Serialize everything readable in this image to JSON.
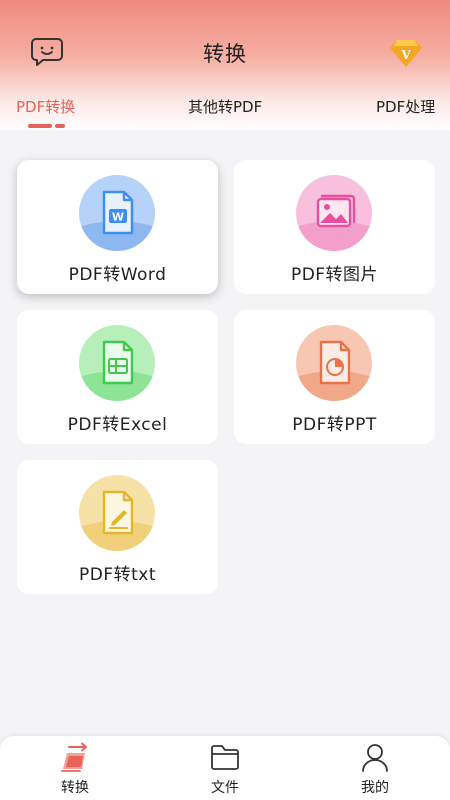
{
  "header": {
    "title": "转换",
    "chat_icon": "chat-bubble-smile-icon",
    "vip_icon": "vip-diamond-icon",
    "vip_letter": "V"
  },
  "tabs": [
    {
      "label": "PDF转换",
      "active": true
    },
    {
      "label": "其他转PDF",
      "active": false
    },
    {
      "label": "PDF处理",
      "active": false
    }
  ],
  "cards": [
    {
      "label": "PDF转Word",
      "icon": "word-file-icon",
      "icon_letter": "W",
      "color": "#3d8ef0"
    },
    {
      "label": "PDF转图片",
      "icon": "image-file-icon",
      "color": "#e84fa0"
    },
    {
      "label": "PDF转Excel",
      "icon": "excel-file-icon",
      "color": "#42c94f"
    },
    {
      "label": "PDF转PPT",
      "icon": "ppt-file-icon",
      "color": "#e8734a"
    },
    {
      "label": "PDF转txt",
      "icon": "txt-file-icon",
      "color": "#e5b52c"
    }
  ],
  "bottom_nav": [
    {
      "label": "转换",
      "icon": "convert-icon",
      "active": true
    },
    {
      "label": "文件",
      "icon": "folder-icon",
      "active": false
    },
    {
      "label": "我的",
      "icon": "user-icon",
      "active": false
    }
  ],
  "colors": {
    "accent": "#e8625a",
    "header_top": "#f08a80",
    "background": "#f4f4f6"
  }
}
